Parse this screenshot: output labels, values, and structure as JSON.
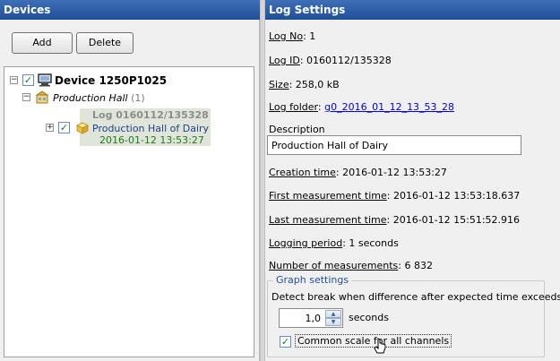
{
  "left_panel": {
    "title": "Devices",
    "add_label": "Add",
    "delete_label": "Delete"
  },
  "tree": {
    "device": {
      "label": "Device 1250P1025",
      "expander": "−",
      "checked": "✓"
    },
    "hall": {
      "label": "Production Hall",
      "count": "(1)",
      "expander": "−"
    },
    "log": {
      "id_label": "Log 0160112/135328",
      "name": "Production Hall of Dairy",
      "time": "2016-01-12 13:53:27",
      "expander": "+",
      "checked": "✓"
    }
  },
  "right_panel": {
    "title": "Log Settings",
    "log_no_key": "Log No",
    "log_no_value": ": 1",
    "log_id_key": "Log ID",
    "log_id_value": ": 0160112/135328",
    "size_key": "Size",
    "size_value": ": 258,0 kB",
    "folder_key": "Log folder",
    "folder_sep": ": ",
    "folder_link": "g0_2016_01_12_13_53_28",
    "description_label": "Description",
    "description_value": "Production Hall of Dairy",
    "creation_key": "Creation time",
    "creation_value": ": 2016-01-12 13:53:27",
    "first_key": "First measurement time",
    "first_value": ": 2016-01-12 13:53:18.637",
    "last_key": "Last measurement time",
    "last_value": ": 2016-01-12 15:51:52.916",
    "period_key": "Logging period",
    "period_value": ": 1 seconds",
    "count_key": "Number of measurements",
    "count_value": ": 6 832"
  },
  "graph_settings": {
    "legend": "Graph settings",
    "break_text": "Detect break when difference after expected time exceeds",
    "spin_value": "1,0",
    "spin_unit": "seconds",
    "common_scale_label": "Common scale for all channels",
    "common_scale_checked": "✓"
  }
}
